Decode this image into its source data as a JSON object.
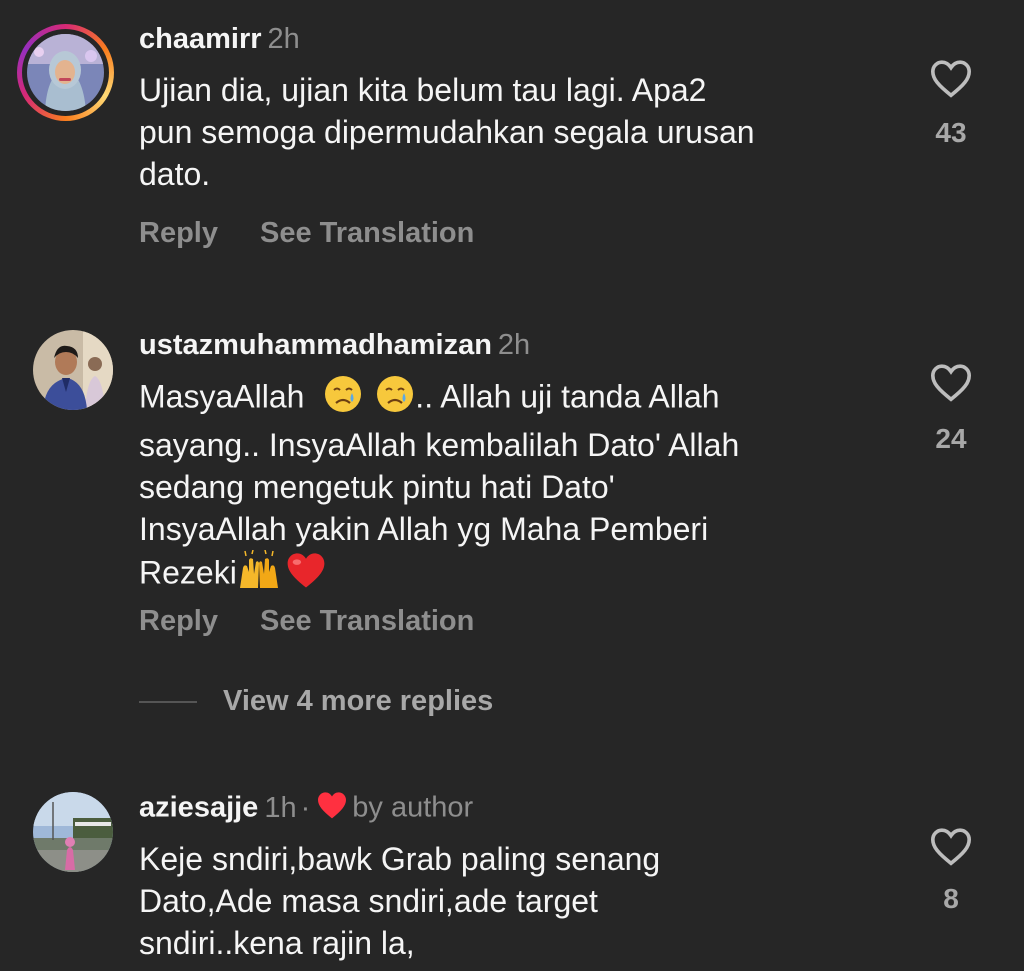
{
  "colors": {
    "background": "#262626",
    "primary_text": "#f5f5f5",
    "secondary_text": "#8e8e8e",
    "like_red": "#ff3040"
  },
  "comments": [
    {
      "username": "chaamirr",
      "time": "2h",
      "lines": [
        "Ujian dia, ujian kita belum tau lagi. Apa2",
        "pun semoga dipermudahkan segala urusan",
        "dato."
      ],
      "like_count": "43",
      "reply_label": "Reply",
      "translate_label": "See Translation",
      "avatar_icon": "profile-photo-hijab"
    },
    {
      "username": "ustazmuhammadhamizan",
      "time": "2h",
      "line1_prefix": "MasyaAllah",
      "line1_suffix": ".. Allah uji tanda Allah",
      "lines": [
        "sayang.. InsyaAllah kembalilah Dato' Allah",
        "sedang mengetuk pintu hati Dato'",
        "InsyaAllah yakin Allah yg Maha Pemberi"
      ],
      "last_line_text": "Rezeki",
      "emojis": [
        "crying-face",
        "crying-face",
        "raising-hands",
        "red-heart"
      ],
      "like_count": "24",
      "reply_label": "Reply",
      "translate_label": "See Translation",
      "view_more_label": "View 4 more replies",
      "avatar_icon": "profile-photo-man"
    },
    {
      "username": "aziesajje",
      "time": "1h",
      "dot": "·",
      "byauthor": "by author",
      "lines": [
        "Keje sndiri,bawk Grab paling senang",
        "Dato,Ade masa sndiri,ade target",
        "sndiri..kena rajin la,"
      ],
      "like_count": "8",
      "avatar_icon": "profile-photo-outdoor"
    }
  ]
}
